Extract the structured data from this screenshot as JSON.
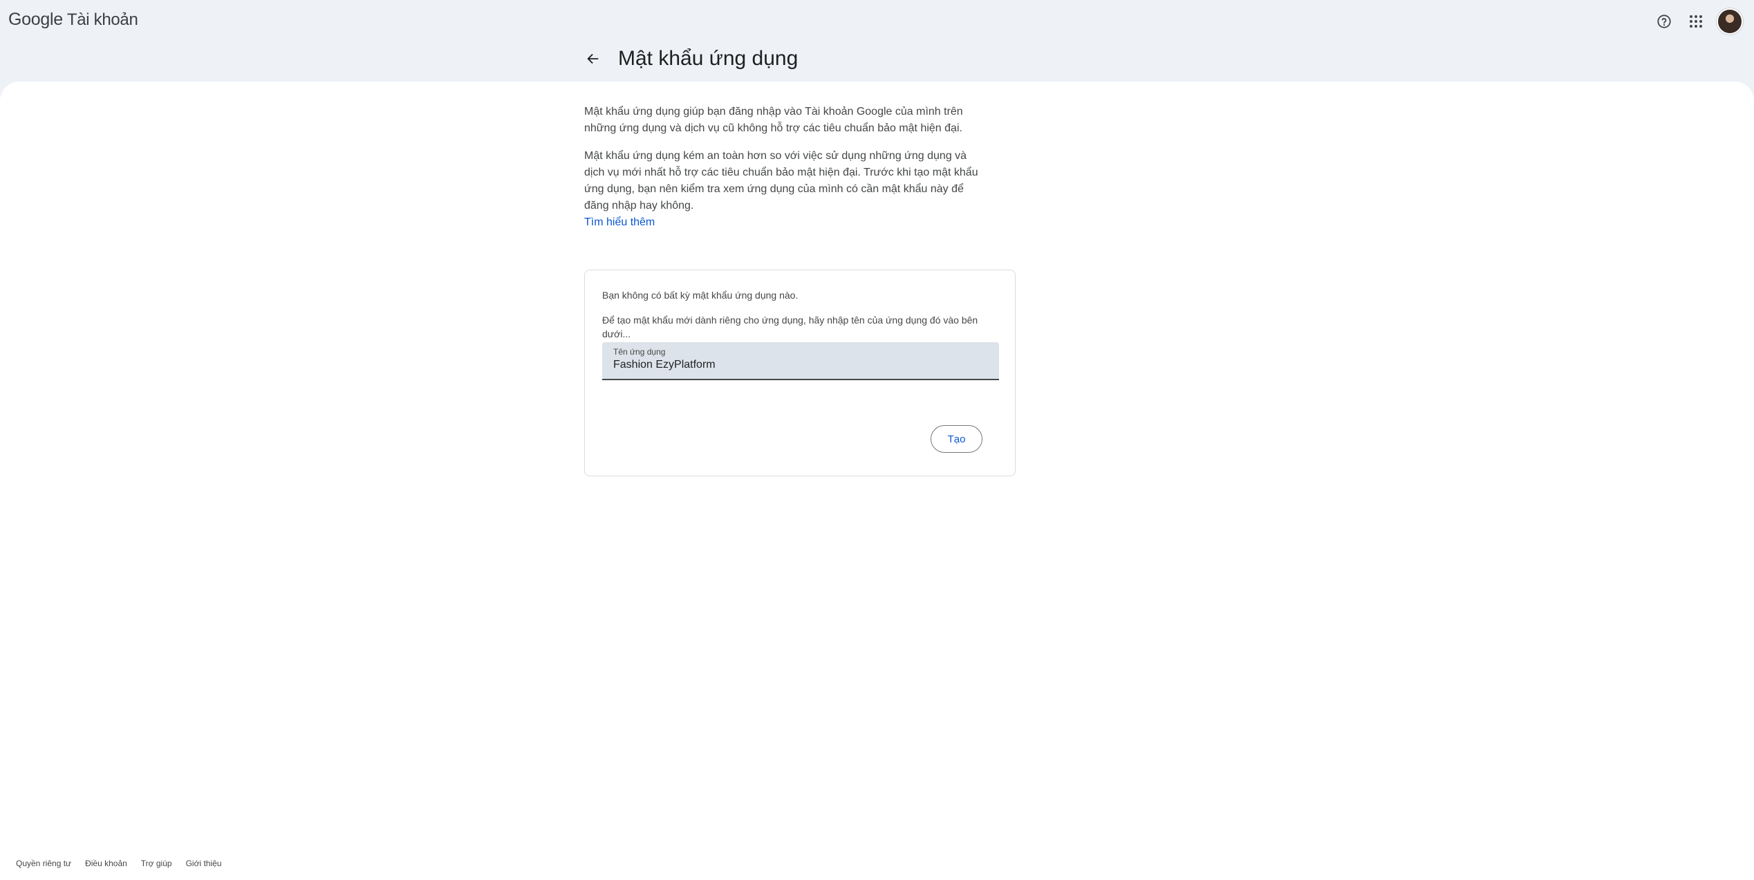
{
  "header": {
    "logo_brand": "Google",
    "logo_product": "Tài khoản"
  },
  "page": {
    "title": "Mật khẩu ứng dụng",
    "intro_1": "Mật khẩu ứng dụng giúp bạn đăng nhập vào Tài khoản Google của mình trên những ứng dụng và dịch vụ cũ không hỗ trợ các tiêu chuẩn bảo mật hiện đại.",
    "intro_2": "Mật khẩu ứng dụng kém an toàn hơn so với việc sử dụng những ứng dụng và dịch vụ mới nhất hỗ trợ các tiêu chuẩn bảo mật hiện đại. Trước khi tạo mật khẩu ứng dụng, bạn nên kiểm tra xem ứng dụng của mình có cần mật khẩu này để đăng nhập hay không.",
    "learn_more": "Tìm hiểu thêm"
  },
  "card": {
    "no_passwords": "Bạn không có bất kỳ mật khẩu ứng dụng nào.",
    "instructions": "Để tạo mật khẩu mới dành riêng cho ứng dụng, hãy nhập tên của ứng dụng đó vào bên dưới...",
    "field_label": "Tên ứng dụng",
    "field_value": "Fashion EzyPlatform",
    "create_label": "Tạo"
  },
  "footer": {
    "privacy": "Quyền riêng tư",
    "terms": "Điều khoản",
    "help": "Trợ giúp",
    "about": "Giới thiệu"
  },
  "icons": {
    "help": "help-circle-icon",
    "apps": "apps-grid-icon",
    "back": "arrow-back-icon"
  },
  "colors": {
    "accent": "#0b57d0",
    "page_bg": "#eef2f7",
    "field_bg": "#dde3ea"
  }
}
